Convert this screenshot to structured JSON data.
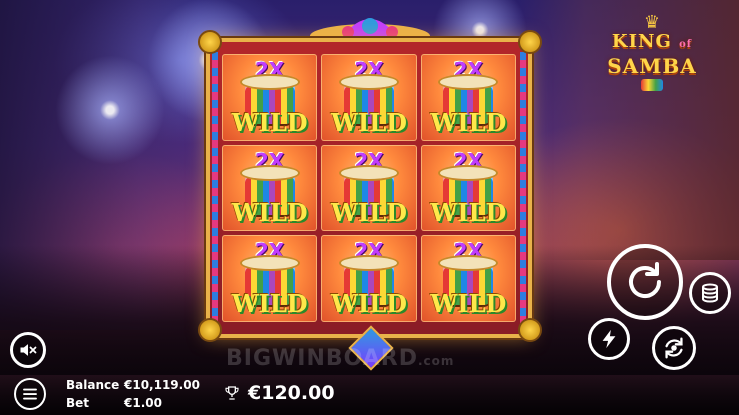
{
  "logo": {
    "line1": "KING",
    "of": "of",
    "line2": "SAMBA"
  },
  "grid": {
    "rows": [
      [
        {
          "multiplier": "2X",
          "label": "WILD"
        },
        {
          "multiplier": "2X",
          "label": "WILD"
        },
        {
          "multiplier": "2X",
          "label": "WILD"
        }
      ],
      [
        {
          "multiplier": "2X",
          "label": "WILD"
        },
        {
          "multiplier": "2X",
          "label": "WILD"
        },
        {
          "multiplier": "2X",
          "label": "WILD"
        }
      ],
      [
        {
          "multiplier": "2X",
          "label": "WILD"
        },
        {
          "multiplier": "2X",
          "label": "WILD"
        },
        {
          "multiplier": "2X",
          "label": "WILD"
        }
      ]
    ]
  },
  "watermark": {
    "text": "BIGWINBOARD",
    "suffix": ".com"
  },
  "status": {
    "balance_label": "Balance",
    "balance_value": "€10,119.00",
    "bet_label": "Bet",
    "bet_value": "€1.00",
    "win_value": "€120.00"
  },
  "icons": {
    "spin": "refresh-icon",
    "stake": "coin-stack-icon",
    "turbo": "lightning-icon",
    "autoplay": "autoplay-icon",
    "sound": "speaker-muted-icon",
    "menu": "hamburger-menu-icon",
    "win": "trophy-icon"
  },
  "colors": {
    "frame_gold": "#e9b24a",
    "frame_red": "#b3262a",
    "wild_yellow": "#ffe84a",
    "mult_purple": "#c13cff"
  }
}
